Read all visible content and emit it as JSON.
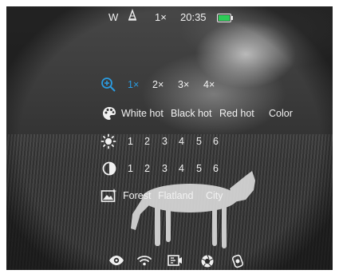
{
  "status": {
    "compass": "W",
    "zoom": "1×",
    "time": "20:35",
    "battery_color": "#2dcc57",
    "icons": [
      "bell-shaped-signal-icon",
      "battery-icon"
    ]
  },
  "zoom_menu": {
    "icon": "zoom-plus-icon",
    "options": [
      "1×",
      "2×",
      "3×",
      "4×"
    ],
    "selected": "1×",
    "accent": "#2a9be0"
  },
  "palette_menu": {
    "icon": "palette-icon",
    "options": [
      "White hot",
      "Black hot",
      "Red hot",
      "Color"
    ]
  },
  "brightness_menu": {
    "icon": "sun-icon",
    "levels": [
      "1",
      "2",
      "3",
      "4",
      "5",
      "6"
    ]
  },
  "contrast_menu": {
    "icon": "contrast-icon",
    "levels": [
      "1",
      "2",
      "3",
      "4",
      "5",
      "6"
    ]
  },
  "scene_menu": {
    "icon": "scene-icon",
    "options": [
      "Forest",
      "Flatland",
      "City"
    ]
  },
  "bottom_bar": {
    "icons": [
      "eye-icon",
      "wifi-icon",
      "record-icon",
      "shutter-icon",
      "settings-icon"
    ]
  }
}
